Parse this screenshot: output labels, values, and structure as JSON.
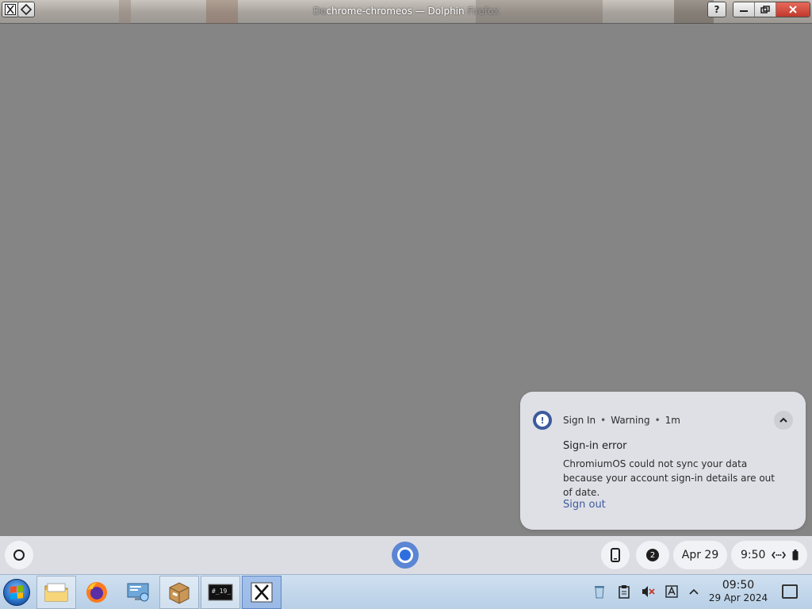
{
  "window": {
    "title": "chrome-chromeos — Dolphin",
    "title_ghost_left": "Do",
    "title_ghost_right": "Firefox",
    "help_label": "?"
  },
  "notification": {
    "source": "Sign In",
    "severity": "Warning",
    "age": "1m",
    "separator": "•",
    "title": "Sign-in error",
    "body": "ChromiumOS could not sync your data because your account sign-in details are out of date.",
    "action_label": "Sign out",
    "accent_color": "#3d5a9e"
  },
  "shelf": {
    "notification_count": "2",
    "date_label": "Apr 29",
    "time_label": "9:50"
  },
  "taskbar": {
    "apps": [
      {
        "name": "file-manager",
        "icon": "folder-icon"
      },
      {
        "name": "firefox",
        "icon": "firefox-icon"
      },
      {
        "name": "remote-desktop",
        "icon": "monitor-icon"
      },
      {
        "name": "package-archive",
        "icon": "package-icon"
      },
      {
        "name": "terminal",
        "icon": "terminal-icon",
        "text": "#_"
      },
      {
        "name": "x-window",
        "icon": "x-icon",
        "text": "X"
      }
    ],
    "clock_time": "09:50",
    "clock_date": "29 Apr 2024"
  }
}
